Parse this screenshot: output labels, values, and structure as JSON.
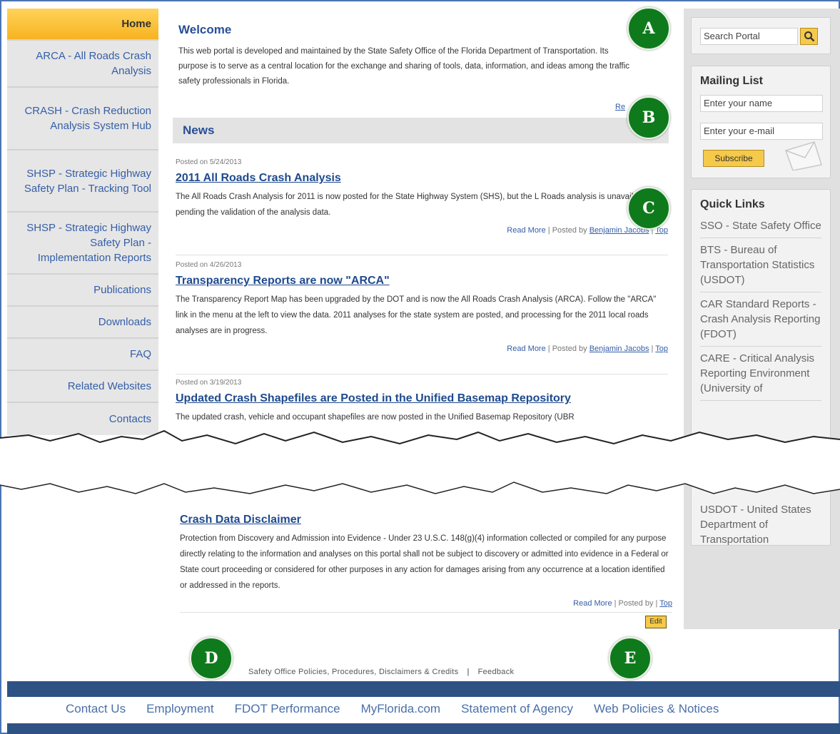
{
  "left_nav": {
    "items": [
      {
        "label": "Home"
      },
      {
        "label": "ARCA - All Roads Crash Analysis"
      },
      {
        "label": "CRASH - Crash Reduction Analysis System Hub"
      },
      {
        "label": "SHSP - Strategic Highway Safety Plan - Tracking Tool"
      },
      {
        "label": "SHSP - Strategic Highway Safety Plan - Implementation Reports"
      },
      {
        "label": "Publications"
      },
      {
        "label": "Downloads"
      },
      {
        "label": "FAQ"
      },
      {
        "label": "Related Websites"
      },
      {
        "label": "Contacts"
      }
    ]
  },
  "welcome": {
    "title": "Welcome",
    "text": "This web portal is developed and maintained by the State Safety Office of the Florida Department of Transportation. Its purpose is to serve as a central location for the exchange and sharing of tools, data, information, and ideas among the traffic safety professionals in Florida.",
    "read_more_cut": "Re"
  },
  "news": {
    "heading": "News",
    "posts": [
      {
        "date": "Posted on 5/24/2013",
        "title": "2011 All Roads Crash Analysis",
        "body": "The All Roads Crash Analysis for 2011 is now posted for the State Highway System (SHS), but the L Roads analysis is unavailable pending the validation of the analysis data.",
        "read_more": "Read More",
        "posted_by": "| Posted by",
        "author": "Benjamin Jacobs",
        "top": "Top"
      },
      {
        "date": "Posted on 4/26/2013",
        "title": "Transparency Reports are now \"ARCA\"",
        "body": "The Transparency Report Map has been upgraded by the DOT and is now the All Roads Crash Analysis (ARCA). Follow the \"ARCA\" link in the menu at the left to view the data. 2011 analyses for the state system are posted, and processing for the 2011 local roads analyses are in progress.",
        "read_more": "Read More",
        "posted_by": "| Posted by",
        "author": "Benjamin Jacobs",
        "top": "Top"
      },
      {
        "date": "Posted on 3/19/2013",
        "title": "Updated Crash Shapefiles are Posted in the Unified Basemap Repository",
        "body": "The updated crash, vehicle and occupant shapefiles are now posted in the Unified Basemap Repository (UBR"
      }
    ],
    "disclaimer": {
      "title": "Crash Data Disclaimer",
      "body": "Protection from Discovery and Admission into Evidence - Under 23 U.S.C. 148(g)(4) information collected or compiled for any purpose directly relating to the information and analyses on this portal shall not be subject to discovery or admitted into evidence in a Federal or State court proceeding or considered for other purposes in any action for damages arising from any occurrence at a location identified or addressed in the reports.",
      "read_more": "Read More",
      "posted_by": "| Posted by",
      "top": "Top",
      "edit": "Edit"
    }
  },
  "sidebar": {
    "search_placeholder": "Search Portal",
    "mailing_title": "Mailing List",
    "name_placeholder": "Enter your name",
    "email_placeholder": "Enter your e-mail",
    "subscribe": "Subscribe",
    "quick_links_title": "Quick Links",
    "quick_links": [
      {
        "label": "SSO - State Safety Office"
      },
      {
        "label": "BTS - Bureau of Transportation Statistics (USDOT)"
      },
      {
        "label": "CAR Standard Reports - Crash Analysis Reporting (FDOT)"
      },
      {
        "label": "CARE - Critical Analysis Reporting Environment (University of"
      }
    ],
    "quick_link_last": "USDOT - United States Department of Transportation"
  },
  "footer": {
    "policies": "Safety Office Policies, Procedures, Disclaimers & Credits",
    "sep": "|",
    "feedback": "Feedback",
    "bottom_links": [
      {
        "label": "Contact Us"
      },
      {
        "label": "Employment"
      },
      {
        "label": "FDOT Performance"
      },
      {
        "label": "MyFlorida.com"
      },
      {
        "label": "Statement of Agency"
      },
      {
        "label": "Web Policies & Notices"
      }
    ]
  },
  "callouts": {
    "a": "A",
    "b": "B",
    "c": "C",
    "d": "D",
    "e": "E"
  }
}
